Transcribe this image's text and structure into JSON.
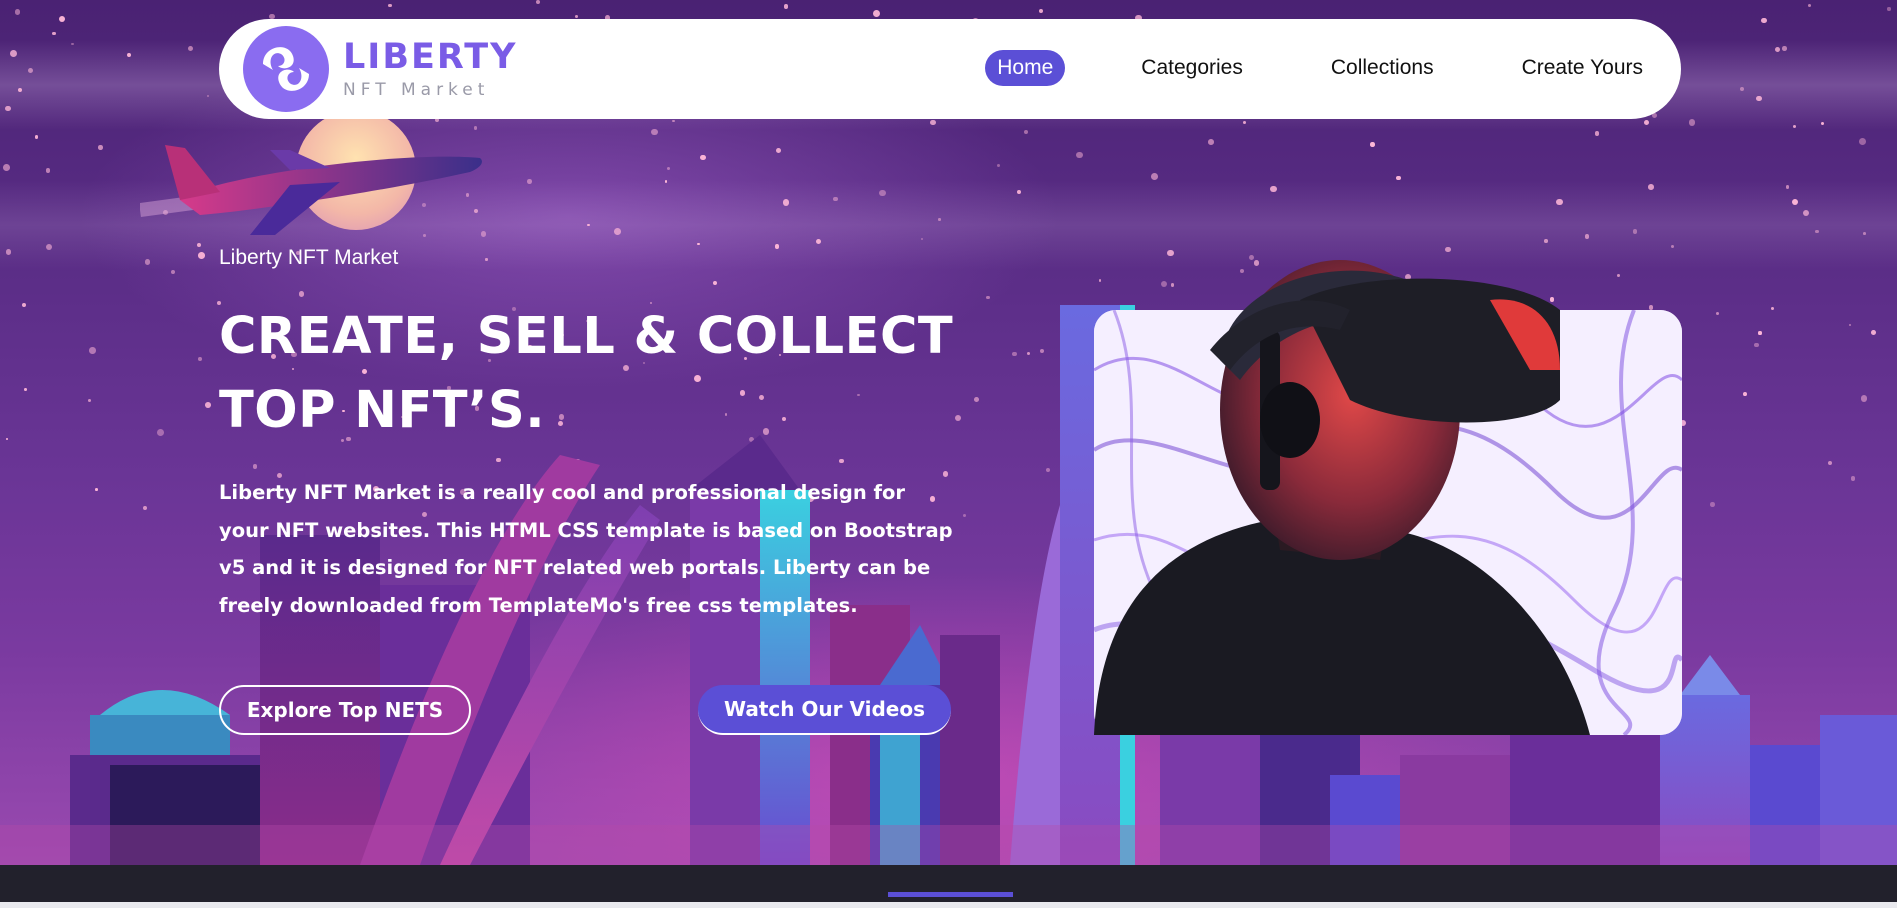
{
  "brand": {
    "title": "LIBERTY",
    "subtitle": "NFT Market",
    "logo_icon": "liberty-logo-icon"
  },
  "nav": {
    "items": [
      {
        "label": "Home",
        "active": true
      },
      {
        "label": "Categories",
        "active": false
      },
      {
        "label": "Collections",
        "active": false
      },
      {
        "label": "Create Yours",
        "active": false
      }
    ]
  },
  "hero": {
    "eyebrow": "Liberty NFT Market",
    "headline_line1": "CREATE, SELL & COLLECT",
    "headline_line2": "TOP NFT’S.",
    "description": "Liberty NFT Market is a really cool and professional design for your NFT websites. This HTML CSS template is based on Bootstrap v5 and it is designed for NFT related web portals. Liberty can be freely downloaded from TemplateMo's free css templates.",
    "primary_button": "Explore Top NETS",
    "secondary_button": "Watch Our Videos"
  },
  "colors": {
    "accent": "#5b4fd6",
    "logo_purple": "#7a5ce6",
    "hero_bg": "#5a2d86",
    "footer_bg": "#22212c"
  }
}
